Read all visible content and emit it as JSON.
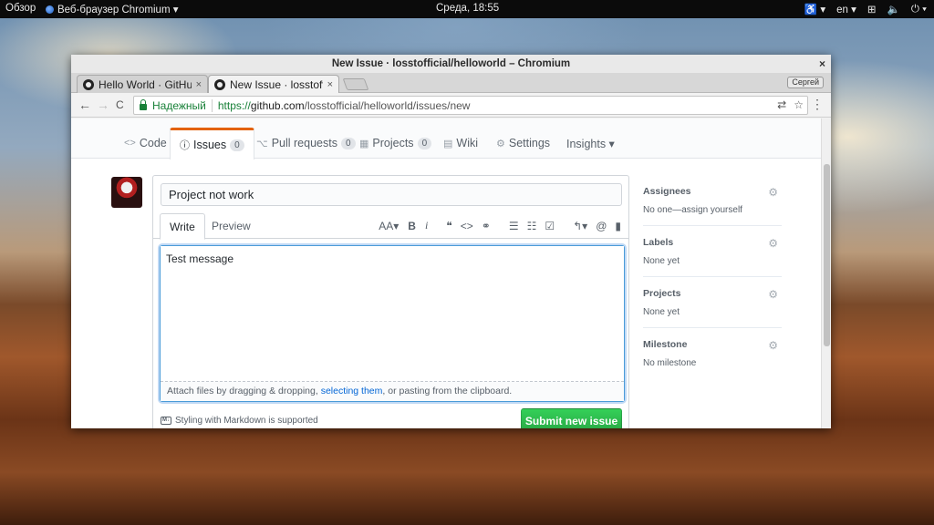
{
  "topbar": {
    "activities": "Обзор",
    "app_name": "Веб-браузер Chromium ▾",
    "clock": "Среда, 18:55",
    "accessibility": "♿ ▾",
    "lang": "en ▾",
    "network": "⊞",
    "volume": "🔈",
    "power": "⏻ ▾"
  },
  "window": {
    "title": "New Issue · losstofficial/helloworld – Chromium",
    "close": "×"
  },
  "tabs": [
    {
      "label": "Hello World · GitHub",
      "close": "×"
    },
    {
      "label": "New Issue · losstoffi",
      "close": "×"
    }
  ],
  "incognito_label": "Сергей",
  "toolbar": {
    "back": "←",
    "forward": "→",
    "reload": "C",
    "secure_label": "Надежный",
    "url_scheme": "https://",
    "url_host": "github.com",
    "url_path": "/losstofficial/helloworld/issues/new",
    "translate": "⇄",
    "star": "☆",
    "menu": "⋮"
  },
  "reponav": {
    "code": {
      "icon": "<>",
      "label": "Code"
    },
    "issues": {
      "icon": "ⓘ",
      "label": "Issues",
      "count": "0"
    },
    "pulls": {
      "icon": "⌥",
      "label": "Pull requests",
      "count": "0"
    },
    "projects": {
      "icon": "▦",
      "label": "Projects",
      "count": "0"
    },
    "wiki": {
      "icon": "▤",
      "label": "Wiki"
    },
    "settings": {
      "icon": "⚙",
      "label": "Settings"
    },
    "insights": {
      "label": "Insights ▾"
    }
  },
  "issue_form": {
    "title_value": "Project not work",
    "tab_write": "Write",
    "tab_preview": "Preview",
    "tools": {
      "heading": "AA▾",
      "bold": "B",
      "italic": "i",
      "quote": "❝",
      "code": "<>",
      "link": "⚭",
      "ul": "☰",
      "ol": "☷",
      "task": "☑",
      "reply": "↰▾",
      "mention": "@",
      "bookmark": "▮"
    },
    "body_value": "Test message",
    "drop_hint_before": "Attach files by dragging & dropping, ",
    "drop_hint_link": "selecting them",
    "drop_hint_after": ", or pasting from the clipboard.",
    "md_note": "Styling with Markdown is supported",
    "md_badge": "M↓",
    "submit": "Submit new issue"
  },
  "sidebar": [
    {
      "heading": "Assignees",
      "value": "No one—assign yourself"
    },
    {
      "heading": "Labels",
      "value": "None yet"
    },
    {
      "heading": "Projects",
      "value": "None yet"
    },
    {
      "heading": "Milestone",
      "value": "No milestone"
    }
  ],
  "gear_icon": "⚙",
  "colors": {
    "accent_orange": "#e36209",
    "submit_green": "#28a745",
    "link_blue": "#0366d6",
    "secure_green": "#188038"
  }
}
